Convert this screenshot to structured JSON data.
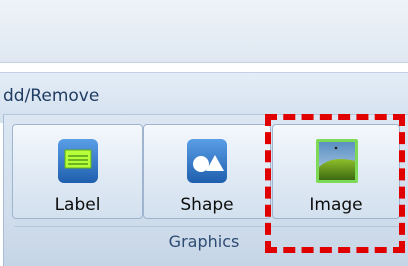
{
  "ribbon": {
    "add_remove_label": "dd/Remove",
    "graphics_group": {
      "caption": "Graphics",
      "buttons": [
        {
          "label": "Label",
          "icon": "label-icon"
        },
        {
          "label": "Shape",
          "icon": "shape-icon"
        },
        {
          "label": "Image",
          "icon": "image-icon"
        }
      ]
    }
  },
  "colors": {
    "highlight": "#e00000",
    "accent_green": "#b7ff3b",
    "icon_blue": "#2f78c8"
  }
}
